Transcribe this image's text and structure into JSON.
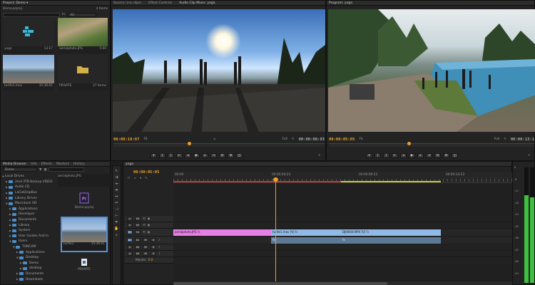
{
  "project": {
    "title": "Project: Demo ▾",
    "bin_path": "Demo.prproj",
    "item_count": "4 Items",
    "search_in": "In:",
    "search_scope": "All",
    "items": [
      {
        "name": "yoga",
        "duration": "13:17",
        "kind": "sequence"
      },
      {
        "name": "aerialphoto.JPG",
        "duration": "5:00",
        "kind": "image"
      },
      {
        "name": "turtle1.mov",
        "duration": "15:36:01",
        "kind": "video"
      },
      {
        "name": "PRIVATE",
        "duration": "27 Items",
        "kind": "folder"
      }
    ]
  },
  "source_monitor": {
    "tab": "Source: (no clips)",
    "tab2": "Effect Controls",
    "tab3": "Audio Clip Mixer: yoga",
    "timecode_in": "00:00:10:07",
    "fit": "Fit",
    "resolution": "Full",
    "timecode_dur": "00:00:08:03"
  },
  "program_monitor": {
    "tab": "Program: yoga",
    "timecode_in": "00:00:05:05",
    "fit": "Fit",
    "resolution": "Full",
    "timecode_dur": "00:00:13:1"
  },
  "media_browser": {
    "tabs": [
      "Media Browser",
      "Info",
      "Effects",
      "Markers",
      "History"
    ],
    "dropdown": "Demo",
    "tree": [
      {
        "label": "Local Drives",
        "depth": 0,
        "open": true,
        "folder": false
      },
      {
        "label": "2md 3TB Backup VIDEO",
        "depth": 1,
        "open": false,
        "folder": true
      },
      {
        "label": "Audio CD",
        "depth": 1,
        "open": false,
        "folder": true
      },
      {
        "label": "LaCieDropBox",
        "depth": 1,
        "open": false,
        "folder": true
      },
      {
        "label": "Library Drives",
        "depth": 1,
        "open": false,
        "folder": true
      },
      {
        "label": "Macintosh HD",
        "depth": 1,
        "open": true,
        "folder": true
      },
      {
        "label": "Applications",
        "depth": 2,
        "open": false,
        "folder": true
      },
      {
        "label": "Developer",
        "depth": 2,
        "open": false,
        "folder": true
      },
      {
        "label": "Documents",
        "depth": 2,
        "open": false,
        "folder": true
      },
      {
        "label": "Library",
        "depth": 2,
        "open": false,
        "folder": true
      },
      {
        "label": "System",
        "depth": 2,
        "open": false,
        "folder": true
      },
      {
        "label": "User Guides And In",
        "depth": 2,
        "open": false,
        "folder": true
      },
      {
        "label": "Users",
        "depth": 2,
        "open": true,
        "folder": true
      },
      {
        "label": "TONCAM",
        "depth": 3,
        "open": true,
        "folder": true
      },
      {
        "label": "Applications",
        "depth": 4,
        "open": false,
        "folder": true
      },
      {
        "label": "Desktop",
        "depth": 4,
        "open": true,
        "folder": true
      },
      {
        "label": "Demo",
        "depth": 5,
        "open": false,
        "folder": true
      },
      {
        "label": "desktop",
        "depth": 5,
        "open": false,
        "folder": true
      },
      {
        "label": "Documents",
        "depth": 4,
        "open": false,
        "folder": true
      },
      {
        "label": "Downloads",
        "depth": 4,
        "open": false,
        "folder": true
      }
    ],
    "thumbs": [
      {
        "name": "aerialphoto.JPG",
        "duration": ""
      },
      {
        "name": "Demo.prproj",
        "duration": ""
      },
      {
        "name": "turtle1",
        "duration": "15:36:01"
      },
      {
        "name": "PRIVATE",
        "duration": ""
      }
    ]
  },
  "timeline": {
    "tab": "yoga",
    "timecode": "00:00:05:05",
    "ruler": [
      "00:00",
      "00:00:04:23",
      "00:00:09:23",
      "00:00:14:23"
    ],
    "video_tracks": [
      "V3",
      "V2",
      "V1"
    ],
    "audio_tracks": [
      "A1",
      "A2",
      "A3"
    ],
    "master": "Master",
    "master_value": "0.0",
    "clips": [
      {
        "label": "aerialphoto.JPG",
        "fx": "fx",
        "color": "#e57ee6"
      },
      {
        "label": "turtle1.mov [V]",
        "fx": "fx",
        "color": "#8fb9e6"
      },
      {
        "label": "DJI0004.MP4 [V]",
        "fx": "fx",
        "color": "#8fb9e6"
      }
    ],
    "audio_clip_labels": [
      "fx",
      "fx"
    ]
  },
  "meters": {
    "labels": [
      "0",
      "-6",
      "-12",
      "-18",
      "-24",
      "-30",
      "-36",
      "-42",
      "-48",
      "-54"
    ],
    "left_level": 0.76,
    "right_level": 0.74,
    "color": "#3fbf3f"
  }
}
